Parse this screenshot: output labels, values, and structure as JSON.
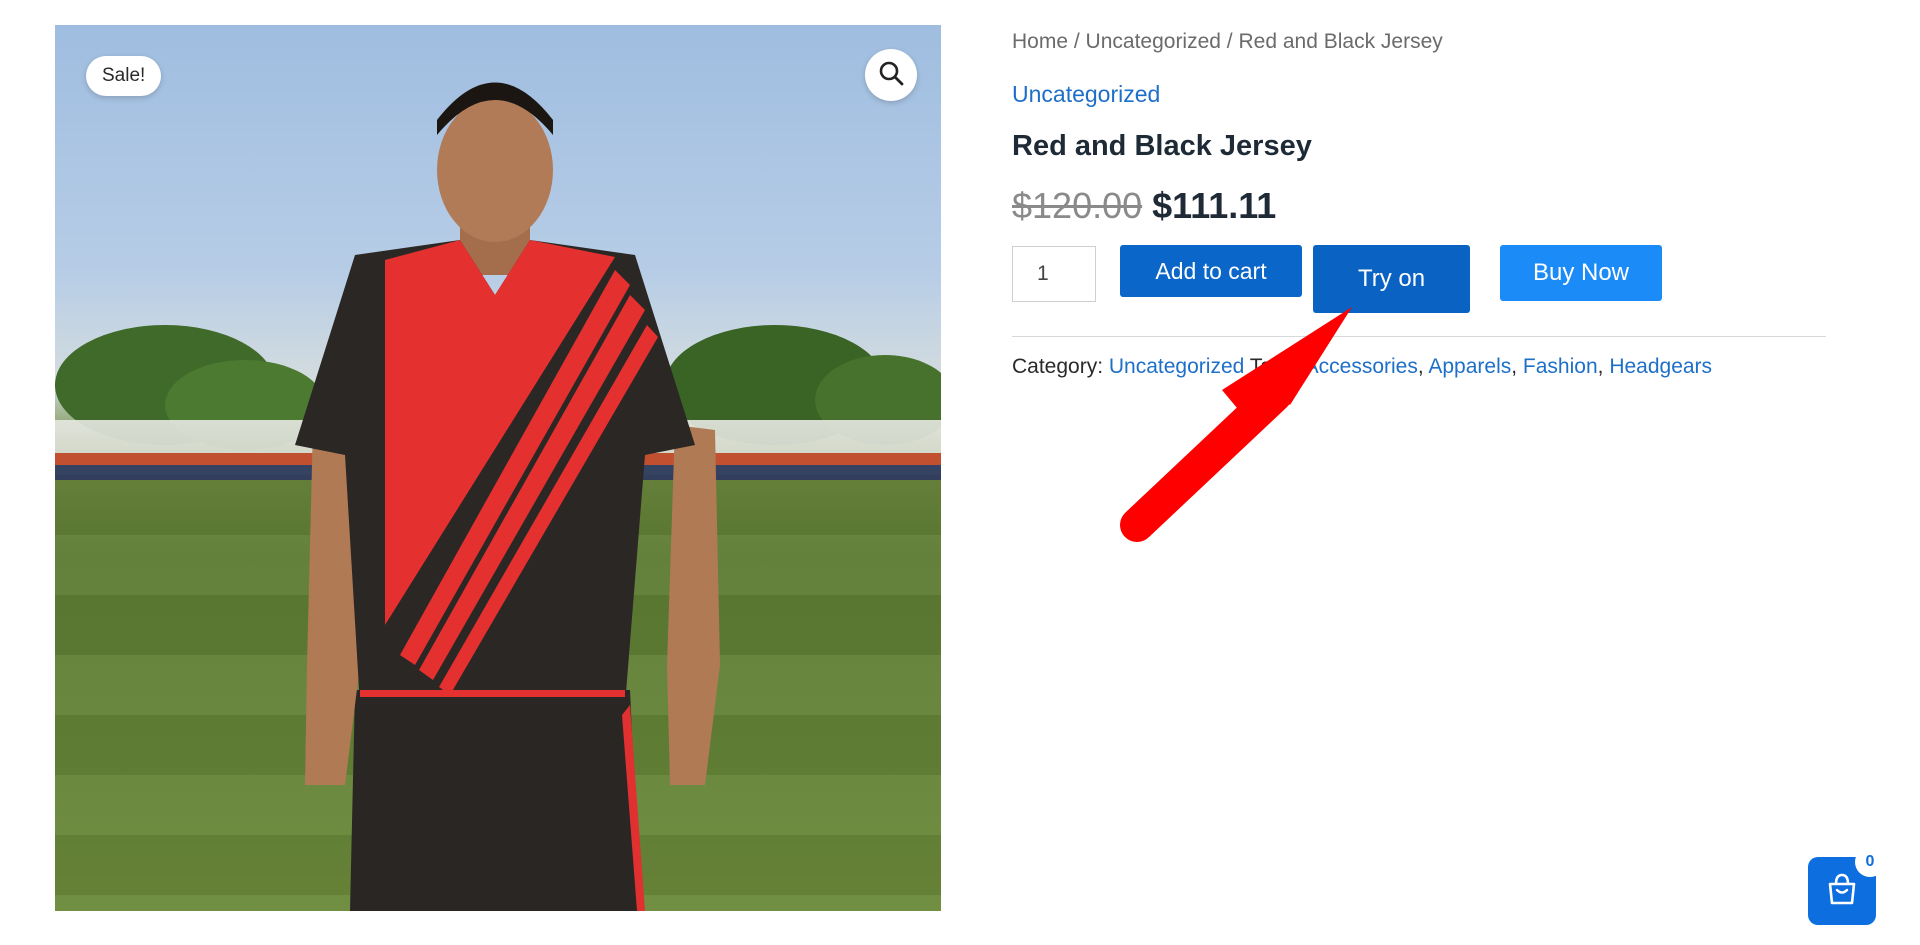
{
  "product_image": {
    "sale_badge": "Sale!",
    "zoom_icon": "search-icon"
  },
  "breadcrumb": {
    "home": "Home",
    "separator": " / ",
    "category": "Uncategorized",
    "current": "Red and Black Jersey"
  },
  "category_link": "Uncategorized",
  "title": "Red and Black Jersey",
  "price": {
    "old": "$120.00",
    "new": "$111.11"
  },
  "quantity": {
    "value": "1"
  },
  "buttons": {
    "add_to_cart": "Add to cart",
    "try_on": "Try on",
    "buy_now": "Buy Now"
  },
  "meta": {
    "category_label": "Category: ",
    "category": "Uncategorized",
    "tags_label": " Tags: ",
    "tags": [
      "Accessories",
      "Apparels",
      "Fashion",
      "Headgears"
    ],
    "tag_separator": ", "
  },
  "cart": {
    "count": "0",
    "icon": "shopping-bag-icon"
  },
  "colors": {
    "primary": "#0a66c8",
    "buy_now": "#1a8bf7",
    "link": "#1e6fc8",
    "arrow": "#ff0000"
  }
}
